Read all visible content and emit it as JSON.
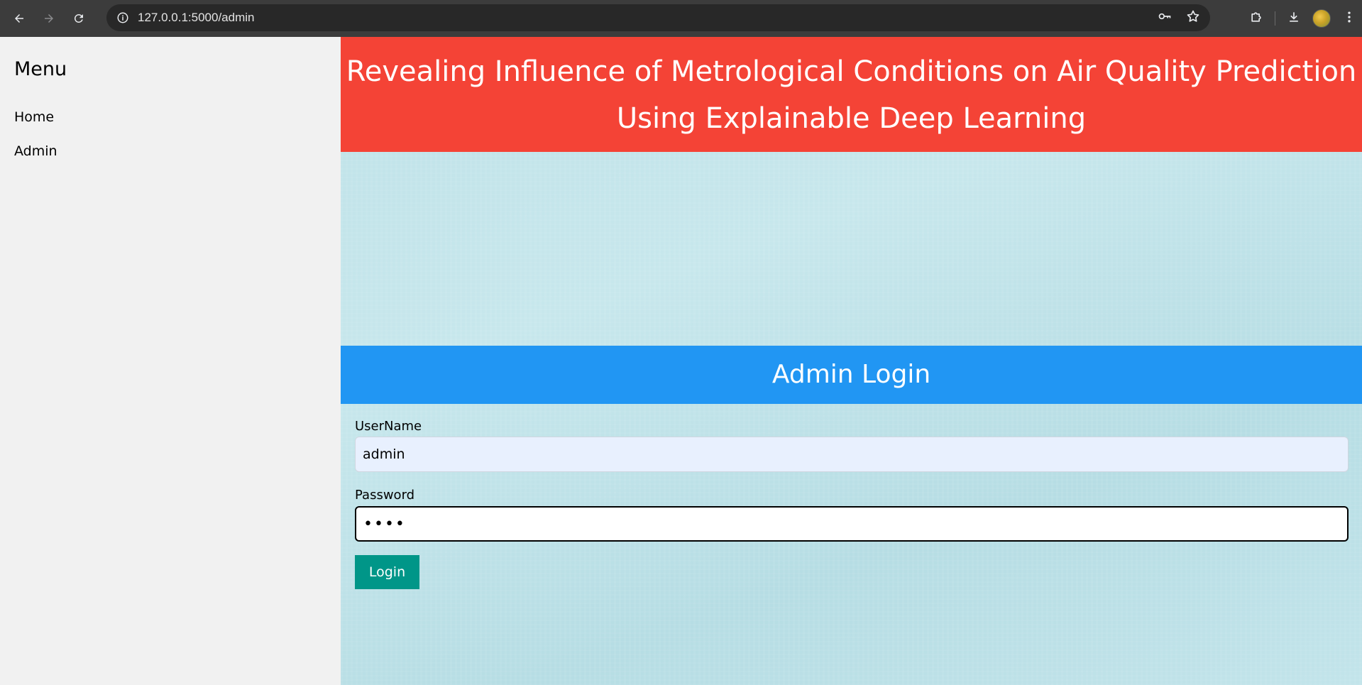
{
  "browser": {
    "url": "127.0.0.1:5000/admin",
    "icons": {
      "back": "arrow-left-icon",
      "forward": "arrow-right-icon",
      "reload": "reload-icon",
      "site_info": "info-icon",
      "password": "key-icon",
      "bookmark": "star-icon",
      "extensions": "puzzle-icon",
      "downloads": "download-icon",
      "menu": "kebab-icon"
    }
  },
  "sidebar": {
    "title": "Menu",
    "items": [
      {
        "label": "Home"
      },
      {
        "label": "Admin"
      }
    ]
  },
  "main": {
    "banner_title": "Revealing Influence of Metrological Conditions on Air Quality Prediction Using Explainable Deep Learning",
    "login_header": "Admin Login",
    "form": {
      "username_label": "UserName",
      "username_value": "admin",
      "password_label": "Password",
      "password_value": "••••",
      "login_button": "Login"
    }
  },
  "colors": {
    "banner": "#f44336",
    "login_header": "#2196f3",
    "login_button": "#009688",
    "sidebar_bg": "#f1f1f1"
  }
}
